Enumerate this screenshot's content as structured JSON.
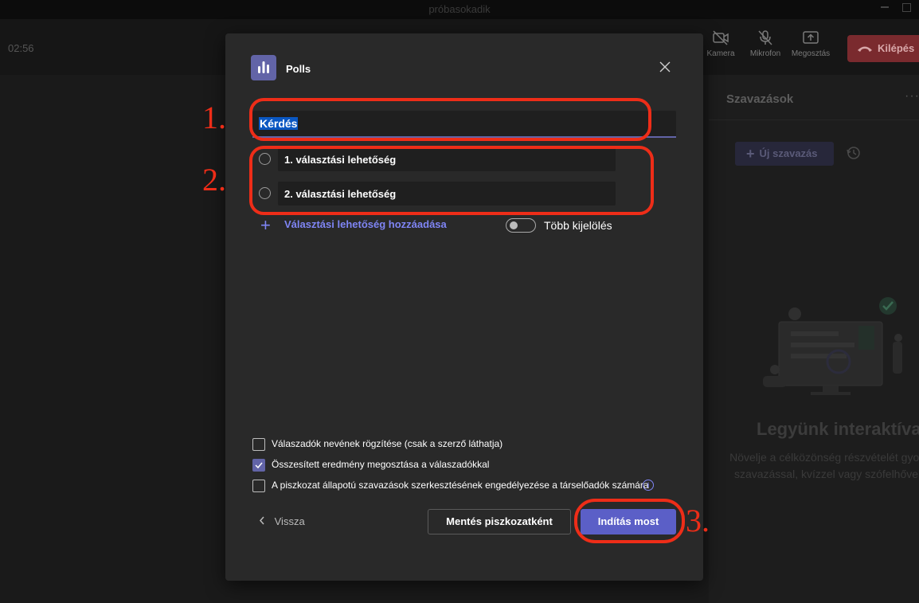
{
  "window": {
    "title": "próbasokadik"
  },
  "meeting": {
    "timer": "02:56",
    "controls": [
      {
        "label": "Kamera",
        "icon": "camera-off-icon"
      },
      {
        "label": "Mikrofon",
        "icon": "mic-off-icon"
      },
      {
        "label": "Megosztás",
        "icon": "share-icon"
      }
    ],
    "leave_label": "Kilépés"
  },
  "side_panel": {
    "title": "Szavazások",
    "more": "···",
    "new_poll_label": "Új szavazás",
    "heading": "Legyünk interaktívak",
    "description": "Növelje a célközönség részvételét gyors szavazással, kvízzel vagy szófelhővel."
  },
  "dialog": {
    "app_name": "Polls",
    "question_value": "Kérdés",
    "options": [
      {
        "label": "1. választási lehetőség"
      },
      {
        "label": "2. választási lehetőség"
      }
    ],
    "add_option_label": "Választási lehetőség hozzáadása",
    "multi_select_label": "Több kijelölés",
    "multi_select_on": false,
    "checkboxes": [
      {
        "label": "Válaszadók nevének rögzítése (csak a szerző láthatja)",
        "checked": false
      },
      {
        "label": "Összesített eredmény megosztása a válaszadókkal",
        "checked": true
      },
      {
        "label": "A piszkozat állapotú szavazások szerkesztésének engedélyezése a társelőadók számára",
        "checked": false
      }
    ],
    "info_glyph": "i",
    "back_label": "Vissza",
    "save_draft_label": "Mentés piszkozatként",
    "start_label": "Indítás most"
  },
  "annotations": {
    "marker1": "1.",
    "marker2": "2.",
    "marker3": "3."
  },
  "colors": {
    "accent": "#6264a7",
    "primary_button": "#5b5fc7",
    "annotation": "#ee2d18",
    "leave": "#7a2a2e"
  }
}
